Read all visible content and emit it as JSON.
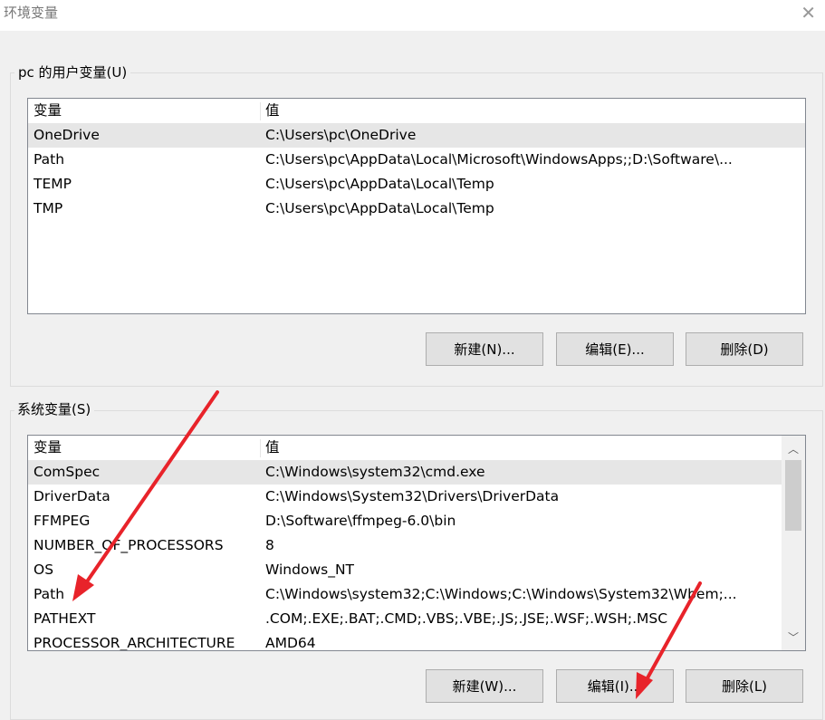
{
  "window": {
    "title": "环境变量"
  },
  "user_vars": {
    "group_label": "pc 的用户变量(U)",
    "col_var": "变量",
    "col_val": "值",
    "rows": [
      {
        "name": "OneDrive",
        "value": "C:\\Users\\pc\\OneDrive"
      },
      {
        "name": "Path",
        "value": "C:\\Users\\pc\\AppData\\Local\\Microsoft\\WindowsApps;;D:\\Software\\..."
      },
      {
        "name": "TEMP",
        "value": "C:\\Users\\pc\\AppData\\Local\\Temp"
      },
      {
        "name": "TMP",
        "value": "C:\\Users\\pc\\AppData\\Local\\Temp"
      }
    ],
    "buttons": {
      "new": "新建(N)...",
      "edit": "编辑(E)...",
      "delete": "删除(D)"
    }
  },
  "system_vars": {
    "group_label": "系统变量(S)",
    "col_var": "变量",
    "col_val": "值",
    "rows": [
      {
        "name": "ComSpec",
        "value": "C:\\Windows\\system32\\cmd.exe"
      },
      {
        "name": "DriverData",
        "value": "C:\\Windows\\System32\\Drivers\\DriverData"
      },
      {
        "name": "FFMPEG",
        "value": "D:\\Software\\ffmpeg-6.0\\bin"
      },
      {
        "name": "NUMBER_OF_PROCESSORS",
        "value": "8"
      },
      {
        "name": "OS",
        "value": "Windows_NT"
      },
      {
        "name": "Path",
        "value": "C:\\Windows\\system32;C:\\Windows;C:\\Windows\\System32\\Wbem;..."
      },
      {
        "name": "PATHEXT",
        "value": ".COM;.EXE;.BAT;.CMD;.VBS;.VBE;.JS;.JSE;.WSF;.WSH;.MSC"
      },
      {
        "name": "PROCESSOR_ARCHITECTURE",
        "value": "AMD64"
      }
    ],
    "buttons": {
      "new": "新建(W)...",
      "edit": "编辑(I)...",
      "delete": "删除(L)"
    }
  },
  "icons": {
    "close": "close-icon",
    "scroll_up": "chevron-up-icon",
    "scroll_down": "chevron-down-icon"
  },
  "colors": {
    "annotation_arrow": "#e8232a",
    "selection": "#e6e6e6"
  }
}
